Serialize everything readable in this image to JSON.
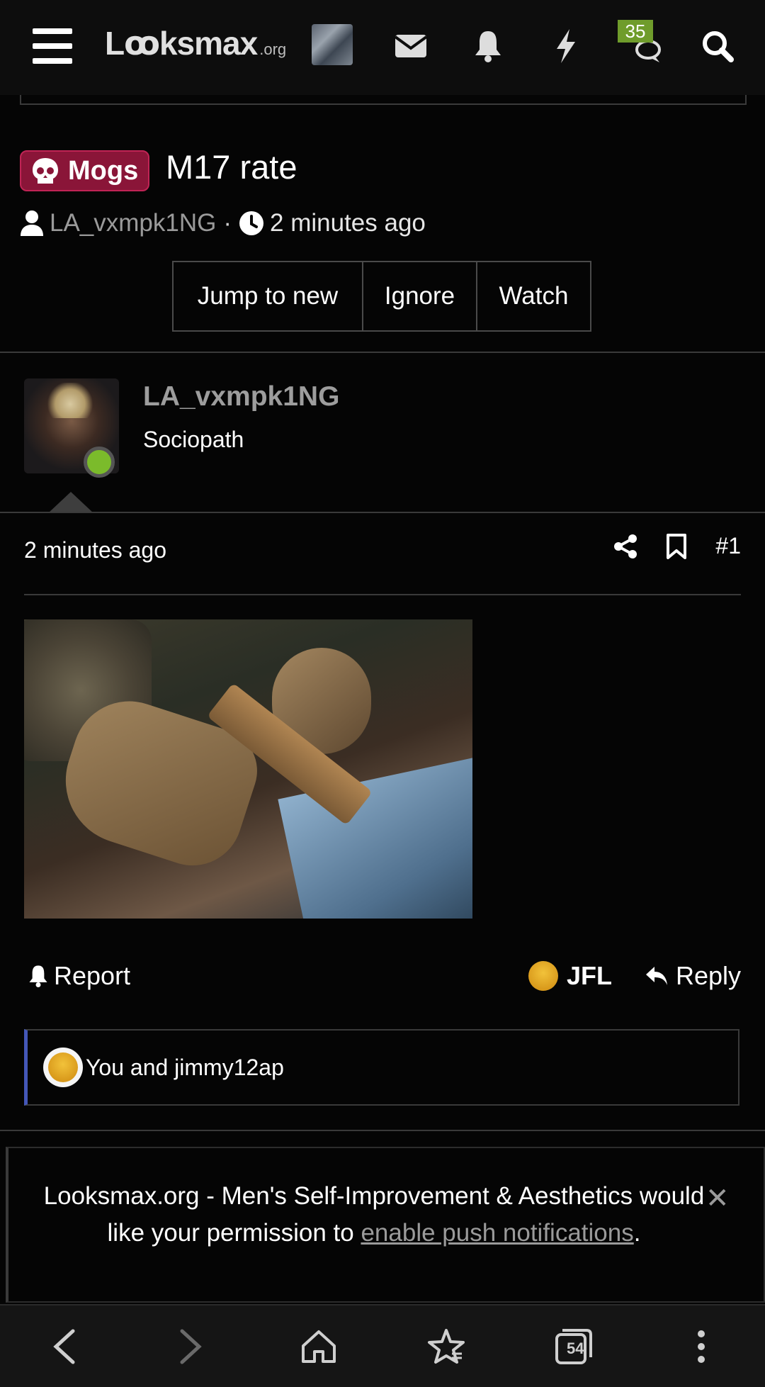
{
  "header": {
    "logo_main": "Lꝏksmax",
    "logo_sub": ".org",
    "badge_count": "35",
    "icons": [
      "menu-icon",
      "mail-icon",
      "bell-icon",
      "lightning-icon",
      "chat-icon",
      "search-icon"
    ]
  },
  "thread": {
    "prefix_label": "Mogs",
    "prefix_color": "#8a1538",
    "title": "M17 rate",
    "author": "LA_vxmpk1NG",
    "separator": "·",
    "time": "2 minutes ago",
    "buttons": [
      "Jump to new",
      "Ignore",
      "Watch"
    ]
  },
  "post": {
    "username": "LA_vxmpk1NG",
    "user_title": "Sociopath",
    "time": "2 minutes ago",
    "number": "#1",
    "report_label": "Report",
    "reaction_label": "JFL",
    "reply_label": "Reply",
    "reactions_text": "You and jimmy12ap"
  },
  "push_banner": {
    "text_before": "Looksmax.org - Men's Self-Improvement & Aesthetics would like your permission to ",
    "link_text": "enable push notifications",
    "text_after": ".",
    "close": "✕"
  },
  "browser_nav": {
    "tabs_count": "54"
  }
}
